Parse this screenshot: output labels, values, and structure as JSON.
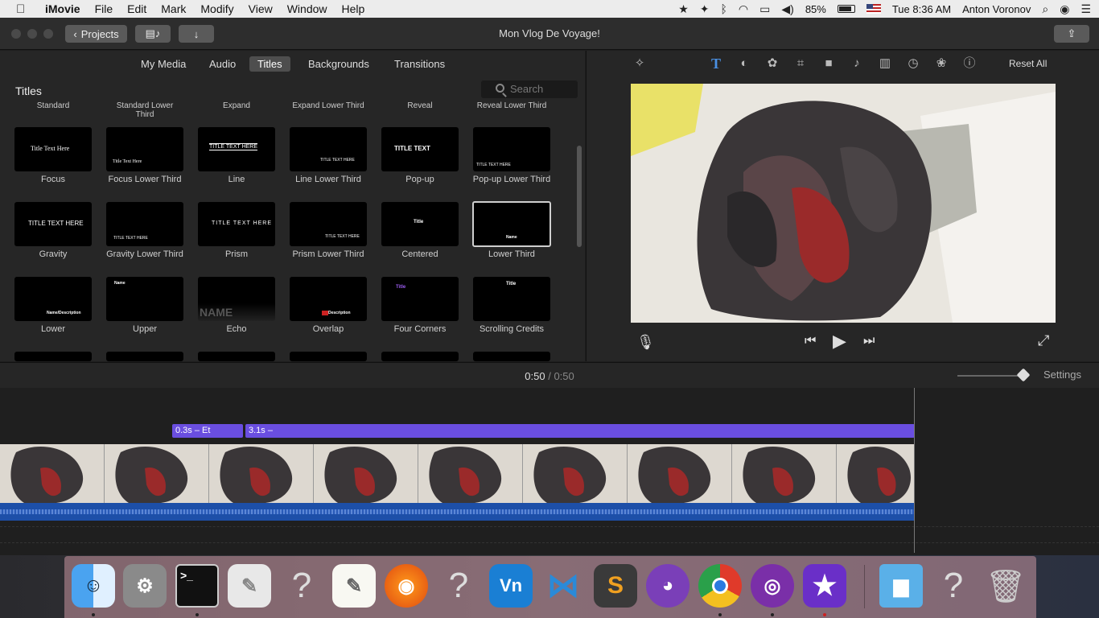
{
  "menubar": {
    "app": "iMovie",
    "menus": [
      "File",
      "Edit",
      "Mark",
      "Modify",
      "View",
      "Window",
      "Help"
    ],
    "battery": "85%",
    "clock": "Tue 8:36 AM",
    "user": "Anton Voronov"
  },
  "window": {
    "title": "Mon Vlog De Voyage!",
    "projects_label": "Projects"
  },
  "browser": {
    "tabs": [
      "My Media",
      "Audio",
      "Titles",
      "Backgrounds",
      "Transitions"
    ],
    "active_tab": "Titles",
    "panel_title": "Titles",
    "search_placeholder": "Search",
    "top_row_labels": [
      "Standard",
      "Standard Lower\nThird",
      "Expand",
      "Expand Lower Third",
      "Reveal",
      "Reveal Lower Third"
    ],
    "rows": [
      [
        {
          "label": "Focus",
          "preview": "Title Text Here"
        },
        {
          "label": "Focus Lower Third",
          "preview": "Title Text Here"
        },
        {
          "label": "Line",
          "preview": "TITLE TEXT HERE"
        },
        {
          "label": "Line Lower Third",
          "preview": "TITLE TEXT HERE"
        },
        {
          "label": "Pop-up",
          "preview": "TITLE TEXT"
        },
        {
          "label": "Pop-up Lower Third",
          "preview": "TITLE TEXT HERE"
        }
      ],
      [
        {
          "label": "Gravity",
          "preview": "TITLE TEXT HERE"
        },
        {
          "label": "Gravity Lower Third",
          "preview": "TITLE TEXT HERE"
        },
        {
          "label": "Prism",
          "preview": "TITLE TEXT HERE"
        },
        {
          "label": "Prism Lower Third",
          "preview": "TITLE TEXT HERE"
        },
        {
          "label": "Centered",
          "preview": "Title"
        },
        {
          "label": "Lower Third",
          "preview": "Name"
        }
      ],
      [
        {
          "label": "Lower",
          "preview": "Name/Description"
        },
        {
          "label": "Upper",
          "preview": "Name"
        },
        {
          "label": "Echo",
          "preview": "NAME"
        },
        {
          "label": "Overlap",
          "preview": "Description"
        },
        {
          "label": "Four Corners",
          "preview": "Title"
        },
        {
          "label": "Scrolling Credits",
          "preview": "Title"
        }
      ]
    ]
  },
  "viewer": {
    "reset_label": "Reset All"
  },
  "timeline": {
    "current_time": "0:50",
    "separator": "/",
    "total_time": "0:50",
    "settings_label": "Settings",
    "title_clips": [
      "0.3s – Et",
      "3.1s –"
    ]
  },
  "dock": {
    "icons": [
      "finder-icon",
      "system-preferences-icon",
      "terminal-icon",
      "script-editor-icon",
      "unknown-app-icon",
      "textedit-icon",
      "firefox-icon",
      "unknown-app-icon",
      "vnc-viewer-icon",
      "vscode-icon",
      "sublime-text-icon",
      "github-desktop-icon",
      "chrome-icon",
      "tor-browser-icon",
      "imovie-icon",
      "downloads-folder-icon",
      "unknown-app-icon",
      "trash-icon"
    ]
  },
  "colors": {
    "accent_blue": "#4a90e2",
    "title_clip": "#6a4ee0",
    "audio_track": "#1d4fa8"
  }
}
